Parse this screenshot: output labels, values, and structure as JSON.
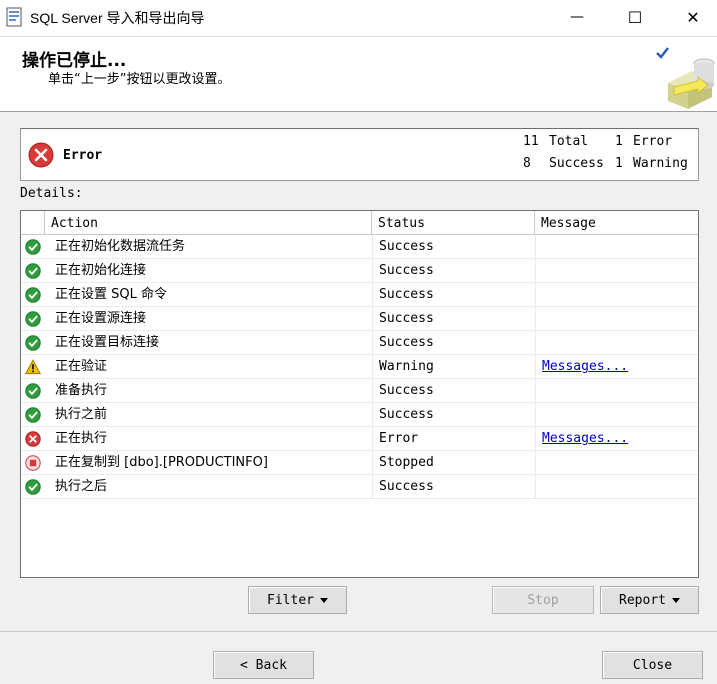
{
  "window": {
    "title": "SQL Server 导入和导出向导",
    "minimize_glyph": "—",
    "maximize_glyph": "☐",
    "close_glyph": "✕"
  },
  "header": {
    "title": "操作已停止...",
    "subtitle": "单击“上一步”按钮以更改设置。"
  },
  "summary": {
    "status": "Error",
    "total_count": "11",
    "total_label": "Total",
    "success_count": "8",
    "success_label": "Success",
    "error_count": "1",
    "error_label": "Error",
    "warning_count": "1",
    "warning_label": "Warning"
  },
  "details": {
    "label": "Details:",
    "columns": [
      "Action",
      "Status",
      "Message"
    ],
    "rows": [
      {
        "icon": "success",
        "action": "正在初始化数据流任务",
        "status": "Success",
        "message": ""
      },
      {
        "icon": "success",
        "action": "正在初始化连接",
        "status": "Success",
        "message": ""
      },
      {
        "icon": "success",
        "action": "正在设置 SQL 命令",
        "status": "Success",
        "message": ""
      },
      {
        "icon": "success",
        "action": "正在设置源连接",
        "status": "Success",
        "message": ""
      },
      {
        "icon": "success",
        "action": "正在设置目标连接",
        "status": "Success",
        "message": ""
      },
      {
        "icon": "warning",
        "action": "正在验证",
        "status": "Warning",
        "message": "Messages..."
      },
      {
        "icon": "success",
        "action": "准备执行",
        "status": "Success",
        "message": ""
      },
      {
        "icon": "success",
        "action": "执行之前",
        "status": "Success",
        "message": ""
      },
      {
        "icon": "error",
        "action": "正在执行",
        "status": "Error",
        "message": "Messages..."
      },
      {
        "icon": "stopped",
        "action": "正在复制到 [dbo].[PRODUCTINFO]",
        "status": "Stopped",
        "message": ""
      },
      {
        "icon": "success",
        "action": "执行之后",
        "status": "Success",
        "message": ""
      }
    ]
  },
  "buttons": {
    "filter": "Filter",
    "stop": "Stop",
    "report": "Report",
    "back": "< Back",
    "close": "Close"
  },
  "colors": {
    "success": "#2e9e3e",
    "warning": "#f2c200",
    "error": "#d83a3a",
    "link": "#0000cc"
  }
}
